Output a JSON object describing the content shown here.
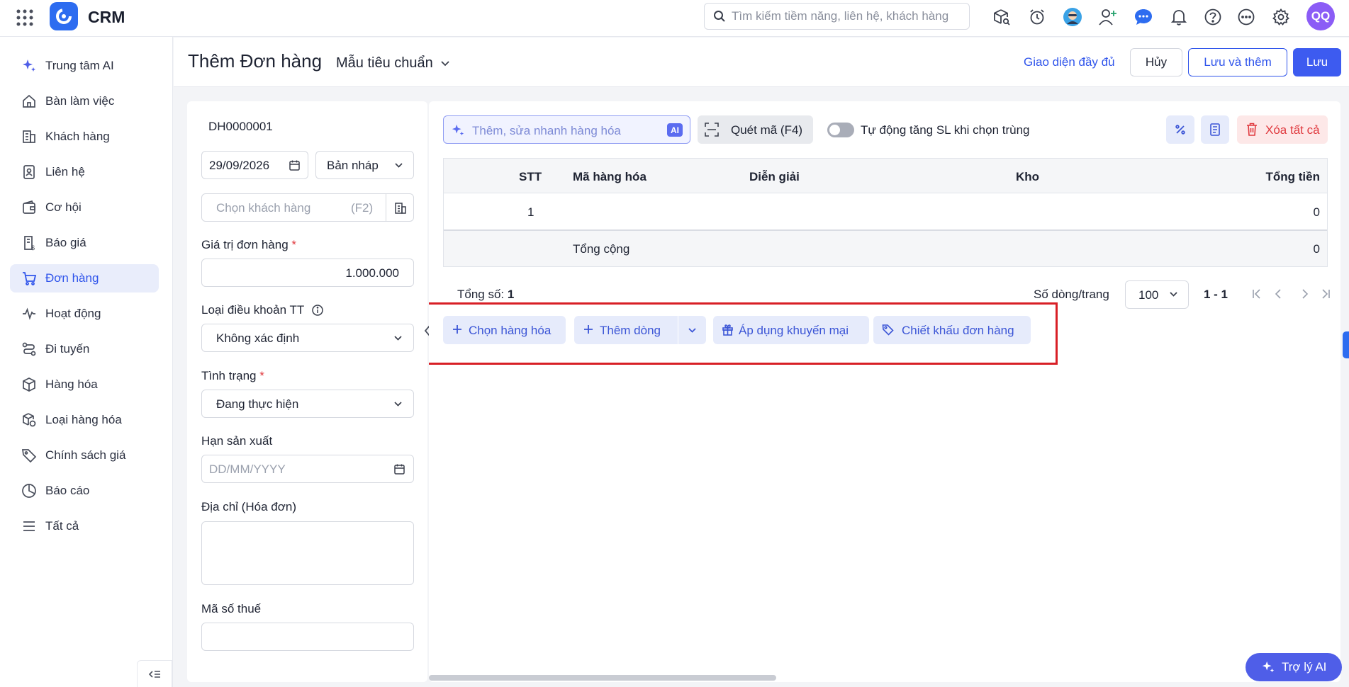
{
  "app": {
    "title": "CRM"
  },
  "search": {
    "placeholder": "Tìm kiếm tiềm năng, liên hệ, khách hàng"
  },
  "user": {
    "initials": "QQ"
  },
  "sidebar": {
    "items": [
      {
        "label": "Trung tâm AI",
        "icon": "ai-sparkle-icon"
      },
      {
        "label": "Bàn làm việc",
        "icon": "home-icon"
      },
      {
        "label": "Khách hàng",
        "icon": "building-icon"
      },
      {
        "label": "Liên hệ",
        "icon": "contact-card-icon"
      },
      {
        "label": "Cơ hội",
        "icon": "wallet-icon"
      },
      {
        "label": "Báo giá",
        "icon": "quote-icon"
      },
      {
        "label": "Đơn hàng",
        "icon": "cart-icon",
        "active": true
      },
      {
        "label": "Hoạt động",
        "icon": "activity-icon"
      },
      {
        "label": "Đi tuyến",
        "icon": "route-icon"
      },
      {
        "label": "Hàng hóa",
        "icon": "box-icon"
      },
      {
        "label": "Loại hàng hóa",
        "icon": "box-category-icon"
      },
      {
        "label": "Chính sách giá",
        "icon": "price-tag-icon"
      },
      {
        "label": "Báo cáo",
        "icon": "pie-chart-icon"
      },
      {
        "label": "Tất cả",
        "icon": "menu-icon"
      }
    ]
  },
  "header": {
    "title": "Thêm Đơn hàng",
    "template": "Mẫu tiêu chuẩn",
    "full_view_link": "Giao diện đầy đủ",
    "cancel_label": "Hủy",
    "save_add_label": "Lưu và thêm",
    "save_label": "Lưu"
  },
  "form": {
    "order_code": "DH0000001",
    "date": "29/09/2026",
    "status_draft": "Bản nháp",
    "customer_placeholder": "Chọn khách hàng",
    "customer_shortcut": "(F2)",
    "order_value_label": "Giá trị đơn hàng",
    "order_value": "1.000.000",
    "payment_terms_label": "Loại điều khoản TT",
    "payment_terms_value": "Không xác định",
    "status_label": "Tình trạng",
    "status_value": "Đang thực hiện",
    "production_deadline_label": "Hạn sản xuất",
    "production_deadline_placeholder": "DD/MM/YYYY",
    "address_label": "Địa chỉ (Hóa đơn)",
    "tax_code_label": "Mã số thuế",
    "required_mark": "*"
  },
  "items": {
    "quick_input_placeholder": "Thêm, sửa nhanh hàng hóa",
    "ai_badge": "AI",
    "scan_label": "Quét mã (F4)",
    "auto_increase_label": "Tự động tăng SL khi chọn trùng",
    "delete_all_label": "Xóa tất cả",
    "columns": [
      "STT",
      "Mã hàng hóa",
      "Diễn giải",
      "Kho",
      "Tổng tiền"
    ],
    "rows": [
      {
        "stt": "1",
        "total": "0"
      }
    ],
    "footer_label": "Tổng cộng",
    "footer_total": "0",
    "total_count_label": "Tổng số:",
    "total_count": "1",
    "rows_per_page_label": "Số dòng/trang",
    "rows_per_page": "100",
    "page_range": "1 - 1",
    "actions": {
      "select_goods": "Chọn hàng hóa",
      "add_row": "Thêm dòng",
      "apply_promo": "Áp dụng khuyến mại",
      "order_discount": "Chiết khấu đơn hàng"
    }
  },
  "ai_assistant": {
    "label": "Trợ lý AI"
  },
  "colors": {
    "accent": "#3d5bf0",
    "danger": "#e0393e",
    "highlight_box": "#d81f26"
  }
}
